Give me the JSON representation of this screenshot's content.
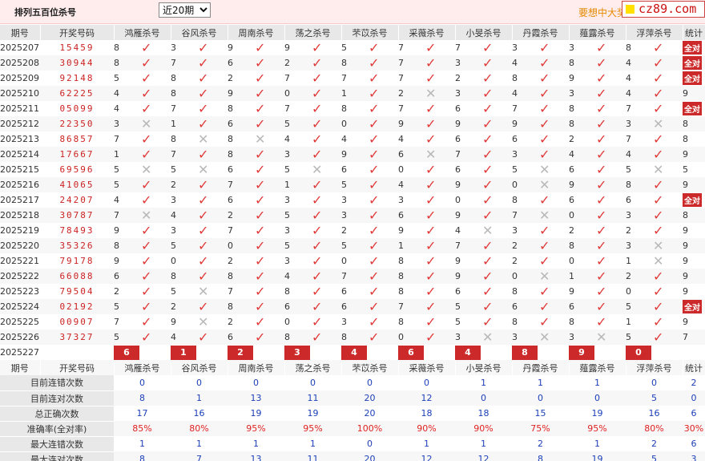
{
  "header": {
    "title": "排列五百位杀号",
    "period_select": "近20期",
    "promo": "要想中大奖",
    "badge": "cz89.com"
  },
  "columns": [
    "期号",
    "开奖号码",
    "鸿雁杀号",
    "谷风杀号",
    "周南杀号",
    "荡之杀号",
    "芣苡杀号",
    "采薇杀号",
    "小旻杀号",
    "丹霞杀号",
    "薤露杀号",
    "浮萍杀号",
    "统计"
  ],
  "all_right_label": "全对",
  "rows": [
    {
      "period": "2025207",
      "code": "15459",
      "p": [
        [
          8,
          1
        ],
        [
          3,
          1
        ],
        [
          9,
          1
        ],
        [
          9,
          1
        ],
        [
          5,
          1
        ],
        [
          7,
          1
        ],
        [
          7,
          1
        ],
        [
          3,
          1
        ],
        [
          3,
          1
        ],
        [
          8,
          1
        ]
      ],
      "stat": "全对"
    },
    {
      "period": "2025208",
      "code": "30944",
      "p": [
        [
          8,
          1
        ],
        [
          7,
          1
        ],
        [
          6,
          1
        ],
        [
          2,
          1
        ],
        [
          8,
          1
        ],
        [
          7,
          1
        ],
        [
          3,
          1
        ],
        [
          4,
          1
        ],
        [
          8,
          1
        ],
        [
          4,
          1
        ]
      ],
      "stat": "全对"
    },
    {
      "period": "2025209",
      "code": "92148",
      "p": [
        [
          5,
          1
        ],
        [
          8,
          1
        ],
        [
          2,
          1
        ],
        [
          7,
          1
        ],
        [
          7,
          1
        ],
        [
          7,
          1
        ],
        [
          2,
          1
        ],
        [
          8,
          1
        ],
        [
          9,
          1
        ],
        [
          4,
          1
        ]
      ],
      "stat": "全对"
    },
    {
      "period": "2025210",
      "code": "62225",
      "p": [
        [
          4,
          1
        ],
        [
          8,
          1
        ],
        [
          9,
          1
        ],
        [
          0,
          1
        ],
        [
          1,
          1
        ],
        [
          2,
          0
        ],
        [
          3,
          1
        ],
        [
          4,
          1
        ],
        [
          3,
          1
        ],
        [
          4,
          1
        ]
      ],
      "stat": "9"
    },
    {
      "period": "2025211",
      "code": "05099",
      "p": [
        [
          4,
          1
        ],
        [
          7,
          1
        ],
        [
          8,
          1
        ],
        [
          7,
          1
        ],
        [
          8,
          1
        ],
        [
          7,
          1
        ],
        [
          6,
          1
        ],
        [
          7,
          1
        ],
        [
          8,
          1
        ],
        [
          7,
          1
        ]
      ],
      "stat": "全对"
    },
    {
      "period": "2025212",
      "code": "22350",
      "p": [
        [
          3,
          0
        ],
        [
          1,
          1
        ],
        [
          6,
          1
        ],
        [
          5,
          1
        ],
        [
          0,
          1
        ],
        [
          9,
          1
        ],
        [
          9,
          1
        ],
        [
          9,
          1
        ],
        [
          8,
          1
        ],
        [
          3,
          0
        ]
      ],
      "stat": "8"
    },
    {
      "period": "2025213",
      "code": "86857",
      "p": [
        [
          7,
          1
        ],
        [
          8,
          0
        ],
        [
          8,
          0
        ],
        [
          4,
          1
        ],
        [
          4,
          1
        ],
        [
          4,
          1
        ],
        [
          6,
          1
        ],
        [
          6,
          1
        ],
        [
          2,
          1
        ],
        [
          7,
          1
        ]
      ],
      "stat": "8"
    },
    {
      "period": "2025214",
      "code": "17667",
      "p": [
        [
          1,
          1
        ],
        [
          7,
          1
        ],
        [
          8,
          1
        ],
        [
          3,
          1
        ],
        [
          9,
          1
        ],
        [
          6,
          0
        ],
        [
          7,
          1
        ],
        [
          3,
          1
        ],
        [
          4,
          1
        ],
        [
          4,
          1
        ]
      ],
      "stat": "9"
    },
    {
      "period": "2025215",
      "code": "69596",
      "p": [
        [
          5,
          0
        ],
        [
          5,
          0
        ],
        [
          6,
          1
        ],
        [
          5,
          0
        ],
        [
          6,
          1
        ],
        [
          0,
          1
        ],
        [
          6,
          1
        ],
        [
          5,
          0
        ],
        [
          6,
          1
        ],
        [
          5,
          0
        ]
      ],
      "stat": "5"
    },
    {
      "period": "2025216",
      "code": "41065",
      "p": [
        [
          5,
          1
        ],
        [
          2,
          1
        ],
        [
          7,
          1
        ],
        [
          1,
          1
        ],
        [
          5,
          1
        ],
        [
          4,
          1
        ],
        [
          9,
          1
        ],
        [
          0,
          0
        ],
        [
          9,
          1
        ],
        [
          8,
          1
        ]
      ],
      "stat": "9"
    },
    {
      "period": "2025217",
      "code": "24207",
      "p": [
        [
          4,
          1
        ],
        [
          3,
          1
        ],
        [
          6,
          1
        ],
        [
          3,
          1
        ],
        [
          3,
          1
        ],
        [
          3,
          1
        ],
        [
          0,
          1
        ],
        [
          8,
          1
        ],
        [
          6,
          1
        ],
        [
          6,
          1
        ]
      ],
      "stat": "全对"
    },
    {
      "period": "2025218",
      "code": "30787",
      "p": [
        [
          7,
          0
        ],
        [
          4,
          1
        ],
        [
          2,
          1
        ],
        [
          5,
          1
        ],
        [
          3,
          1
        ],
        [
          6,
          1
        ],
        [
          9,
          1
        ],
        [
          7,
          0
        ],
        [
          0,
          1
        ],
        [
          3,
          1
        ]
      ],
      "stat": "8"
    },
    {
      "period": "2025219",
      "code": "78493",
      "p": [
        [
          9,
          1
        ],
        [
          3,
          1
        ],
        [
          7,
          1
        ],
        [
          3,
          1
        ],
        [
          2,
          1
        ],
        [
          9,
          1
        ],
        [
          4,
          0
        ],
        [
          3,
          1
        ],
        [
          2,
          1
        ],
        [
          2,
          1
        ]
      ],
      "stat": "9"
    },
    {
      "period": "2025220",
      "code": "35326",
      "p": [
        [
          8,
          1
        ],
        [
          5,
          1
        ],
        [
          0,
          1
        ],
        [
          5,
          1
        ],
        [
          5,
          1
        ],
        [
          1,
          1
        ],
        [
          7,
          1
        ],
        [
          2,
          1
        ],
        [
          8,
          1
        ],
        [
          3,
          0
        ]
      ],
      "stat": "9"
    },
    {
      "period": "2025221",
      "code": "79178",
      "p": [
        [
          9,
          1
        ],
        [
          0,
          1
        ],
        [
          2,
          1
        ],
        [
          3,
          1
        ],
        [
          0,
          1
        ],
        [
          8,
          1
        ],
        [
          9,
          1
        ],
        [
          2,
          1
        ],
        [
          0,
          1
        ],
        [
          1,
          0
        ]
      ],
      "stat": "9"
    },
    {
      "period": "2025222",
      "code": "66088",
      "p": [
        [
          6,
          1
        ],
        [
          8,
          1
        ],
        [
          8,
          1
        ],
        [
          4,
          1
        ],
        [
          7,
          1
        ],
        [
          8,
          1
        ],
        [
          9,
          1
        ],
        [
          0,
          0
        ],
        [
          1,
          1
        ],
        [
          2,
          1
        ]
      ],
      "stat": "9"
    },
    {
      "period": "2025223",
      "code": "79504",
      "p": [
        [
          2,
          1
        ],
        [
          5,
          0
        ],
        [
          7,
          1
        ],
        [
          8,
          1
        ],
        [
          6,
          1
        ],
        [
          8,
          1
        ],
        [
          6,
          1
        ],
        [
          8,
          1
        ],
        [
          9,
          1
        ],
        [
          0,
          1
        ]
      ],
      "stat": "9"
    },
    {
      "period": "2025224",
      "code": "02192",
      "p": [
        [
          5,
          1
        ],
        [
          2,
          1
        ],
        [
          8,
          1
        ],
        [
          6,
          1
        ],
        [
          6,
          1
        ],
        [
          7,
          1
        ],
        [
          5,
          1
        ],
        [
          6,
          1
        ],
        [
          6,
          1
        ],
        [
          5,
          1
        ]
      ],
      "stat": "全对"
    },
    {
      "period": "2025225",
      "code": "00907",
      "p": [
        [
          7,
          1
        ],
        [
          9,
          0
        ],
        [
          2,
          1
        ],
        [
          0,
          1
        ],
        [
          3,
          1
        ],
        [
          8,
          1
        ],
        [
          5,
          1
        ],
        [
          8,
          1
        ],
        [
          8,
          1
        ],
        [
          1,
          1
        ]
      ],
      "stat": "9"
    },
    {
      "period": "2025226",
      "code": "37327",
      "p": [
        [
          5,
          1
        ],
        [
          4,
          1
        ],
        [
          6,
          1
        ],
        [
          8,
          1
        ],
        [
          8,
          1
        ],
        [
          0,
          1
        ],
        [
          3,
          0
        ],
        [
          3,
          0
        ],
        [
          3,
          0
        ],
        [
          5,
          1
        ]
      ],
      "stat": "7"
    }
  ],
  "current": {
    "period": "2025227",
    "label": "当前期杀号",
    "values": [
      "6",
      "1",
      "2",
      "3",
      "4",
      "6",
      "4",
      "8",
      "9",
      "0"
    ]
  },
  "summary": [
    {
      "label": "目前连错次数",
      "values": [
        "0",
        "0",
        "0",
        "0",
        "0",
        "0",
        "1",
        "1",
        "1",
        "0"
      ],
      "stat": "2"
    },
    {
      "label": "目前连对次数",
      "values": [
        "8",
        "1",
        "13",
        "11",
        "20",
        "12",
        "0",
        "0",
        "0",
        "5"
      ],
      "stat": "0"
    },
    {
      "label": "总正确次数",
      "values": [
        "17",
        "16",
        "19",
        "19",
        "20",
        "18",
        "18",
        "15",
        "19",
        "16"
      ],
      "stat": "6"
    },
    {
      "label": "准确率(全对率)",
      "values": [
        "85%",
        "80%",
        "95%",
        "95%",
        "100%",
        "90%",
        "90%",
        "75%",
        "95%",
        "80%"
      ],
      "stat": "30%",
      "red": true
    },
    {
      "label": "最大连错次数",
      "values": [
        "1",
        "1",
        "1",
        "1",
        "0",
        "1",
        "1",
        "2",
        "1",
        "2"
      ],
      "stat": "6"
    },
    {
      "label": "最大连对次数",
      "values": [
        "8",
        "7",
        "13",
        "11",
        "20",
        "12",
        "12",
        "8",
        "19",
        "5"
      ],
      "stat": "3"
    }
  ],
  "icons": {
    "correct": "check-mark-icon",
    "wrong": "cross-mark-icon"
  },
  "colors": {
    "accent": "#cc2a2a",
    "correct": "#e03a3a",
    "wrong": "#b8b8b8",
    "stat_blue": "#1c3fb7",
    "header_bg": "#e8e8e8",
    "topbar_bg": "#ffecec"
  }
}
